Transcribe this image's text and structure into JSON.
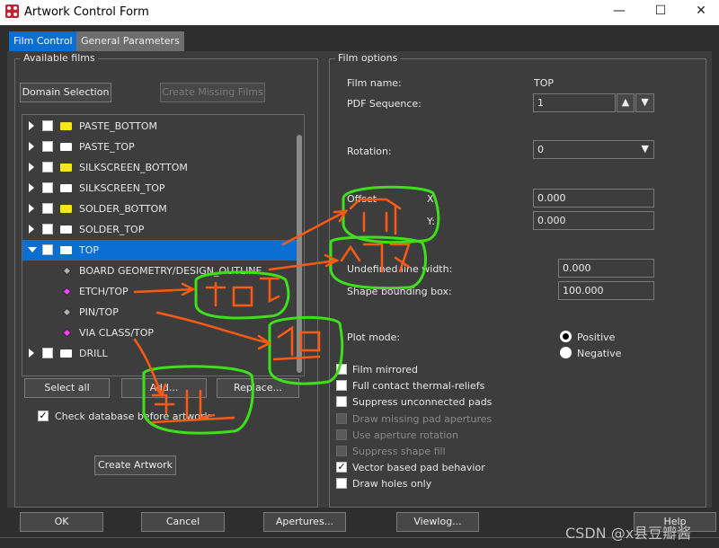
{
  "window": {
    "title": "Artwork Control Form",
    "minimize": "—",
    "maximize": "☐",
    "close": "✕"
  },
  "tabs": [
    {
      "label": "Film Control",
      "active": true
    },
    {
      "label": "General Parameters",
      "active": false
    }
  ],
  "available_films": {
    "title": "Available films",
    "domain_selection": "Domain Selection",
    "create_missing": "Create Missing Films",
    "tree": [
      {
        "label": "PASTE_BOTTOM",
        "folder": "#f5e61a",
        "expanded": false
      },
      {
        "label": "PASTE_TOP",
        "folder": "#ffffff",
        "expanded": false
      },
      {
        "label": "SILKSCREEN_BOTTOM",
        "folder": "#f5e61a",
        "expanded": false
      },
      {
        "label": "SILKSCREEN_TOP",
        "folder": "#ffffff",
        "expanded": false
      },
      {
        "label": "SOLDER_BOTTOM",
        "folder": "#f5e61a",
        "expanded": false
      },
      {
        "label": "SOLDER_TOP",
        "folder": "#ffffff",
        "expanded": false
      },
      {
        "label": "TOP",
        "folder": "#ffffff",
        "expanded": true,
        "selected": true
      },
      {
        "label": "BOARD GEOMETRY/DESIGN_OUTLINE",
        "layer_color": "#b0b0b0",
        "child": true
      },
      {
        "label": "ETCH/TOP",
        "layer_color": "#ff40ff",
        "child": true
      },
      {
        "label": "PIN/TOP",
        "layer_color": "#b0b0b0",
        "child": true
      },
      {
        "label": "VIA CLASS/TOP",
        "layer_color": "#ff40ff",
        "child": true
      },
      {
        "label": "DRILL",
        "folder": "#ffffff",
        "expanded": false
      }
    ],
    "select_all": "Select all",
    "add": "Add...",
    "replace": "Replace...",
    "check_db": "Check database before artwork",
    "check_db_checked": true,
    "create_artwork": "Create Artwork"
  },
  "film_options": {
    "title": "Film options",
    "film_name_label": "Film name:",
    "film_name": "TOP",
    "pdf_seq_label": "PDF Sequence:",
    "pdf_seq": "1",
    "rotation_label": "Rotation:",
    "rotation": "0",
    "offset_label": "Offset",
    "x_label": "X:",
    "x": "0.000",
    "y_label": "Y:",
    "y": "0.000",
    "undef_width_label": "Undefined line width:",
    "undef_width": "0.000",
    "shape_bbox_label": "Shape bounding box:",
    "shape_bbox": "100.000",
    "plot_mode_label": "Plot mode:",
    "positive": "Positive",
    "negative": "Negative",
    "plot_mode": "Positive",
    "checks": [
      {
        "label": "Film mirrored",
        "checked": false,
        "enabled": true
      },
      {
        "label": "Full contact thermal-reliefs",
        "checked": false,
        "enabled": true
      },
      {
        "label": "Suppress unconnected pads",
        "checked": false,
        "enabled": true
      },
      {
        "label": "Draw missing pad apertures",
        "checked": false,
        "enabled": false
      },
      {
        "label": "Use aperture rotation",
        "checked": false,
        "enabled": false
      },
      {
        "label": "Suppress shape fill",
        "checked": false,
        "enabled": false
      },
      {
        "label": "Vector based pad behavior",
        "checked": true,
        "enabled": true
      },
      {
        "label": "Draw holes only",
        "checked": false,
        "enabled": true
      }
    ]
  },
  "footer": {
    "ok": "OK",
    "cancel": "Cancel",
    "apertures": "Apertures...",
    "viewlog": "Viewlog...",
    "help": "Help"
  },
  "watermark": "CSDN @x县豆瓣酱",
  "annotations": [
    "顶层",
    "板框",
    "铜皮",
    "焊盘",
    "过孔"
  ],
  "colors": {
    "accent": "#0a6fd0",
    "annotation_loop": "#3ee01a",
    "annotation_arrow": "#ff5a14"
  }
}
